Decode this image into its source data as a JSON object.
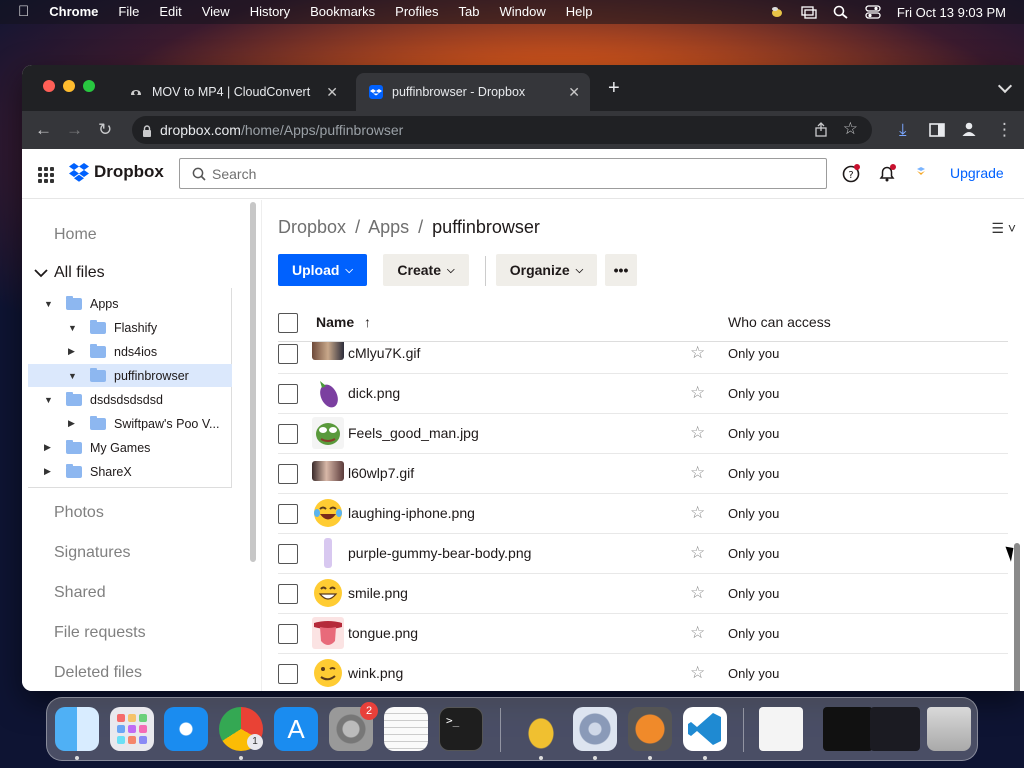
{
  "menubar": {
    "items": [
      "Chrome",
      "File",
      "Edit",
      "View",
      "History",
      "Bookmarks",
      "Profiles",
      "Tab",
      "Window",
      "Help"
    ],
    "clock": "Fri Oct 13  9:03 PM"
  },
  "browser": {
    "tabs": [
      {
        "title": "MOV to MP4 | CloudConvert",
        "icon": "cloudconvert-icon"
      },
      {
        "title": "puffinbrowser - Dropbox",
        "icon": "dropbox-icon"
      }
    ],
    "url_domain": "dropbox.com",
    "url_path": "/home/Apps/puffinbrowser"
  },
  "dropbox": {
    "logo_text": "Dropbox",
    "search_placeholder": "Search",
    "upgrade_label": "Upgrade",
    "colors": {
      "brand": "#0061fe",
      "selected_row": "#dbe8fc",
      "button_bg": "#f0eee9"
    },
    "sidebar": {
      "home": "Home",
      "all_files": "All files",
      "tree": [
        {
          "label": "Apps",
          "expanded": true
        },
        {
          "label": "Flashify",
          "expanded": true
        },
        {
          "label": "nds4ios",
          "expanded": false
        },
        {
          "label": "puffinbrowser",
          "expanded": true,
          "selected": true
        },
        {
          "label": "dsdsdsdsdsd",
          "expanded": true
        },
        {
          "label": "Swiftpaw's Poo V...",
          "expanded": false
        },
        {
          "label": "My Games",
          "expanded": false
        },
        {
          "label": "ShareX",
          "expanded": false
        }
      ],
      "bottom_links": [
        "Photos",
        "Signatures",
        "Shared",
        "File requests",
        "Deleted files"
      ]
    },
    "breadcrumb": {
      "root": "Dropbox",
      "sep": "/",
      "mid": "Apps",
      "current": "puffinbrowser"
    },
    "actions": {
      "upload": "Upload",
      "create": "Create",
      "organize": "Organize",
      "more": "•••"
    },
    "columns": {
      "name": "Name",
      "sort_icon": "↑",
      "access": "Who can access"
    },
    "files": [
      {
        "name": "cMlyu7K.gif",
        "access": "Only you",
        "thumb": "gif-thumb"
      },
      {
        "name": "dick.png",
        "access": "Only you",
        "thumb": "eggplant-thumb"
      },
      {
        "name": "Feels_good_man.jpg",
        "access": "Only you",
        "thumb": "pepe-thumb"
      },
      {
        "name": "l60wlp7.gif",
        "access": "Only you",
        "thumb": "gif-thumb"
      },
      {
        "name": "laughing-iphone.png",
        "access": "Only you",
        "thumb": "laughing-emoji-thumb"
      },
      {
        "name": "purple-gummy-bear-body.png",
        "access": "Only you",
        "thumb": "gummy-bear-thumb"
      },
      {
        "name": "smile.png",
        "access": "Only you",
        "thumb": "smile-emoji-thumb"
      },
      {
        "name": "tongue.png",
        "access": "Only you",
        "thumb": "tongue-thumb"
      },
      {
        "name": "wink.png",
        "access": "Only you",
        "thumb": "wink-emoji-thumb"
      }
    ]
  },
  "dock": {
    "settings_badge": "2",
    "chrome_badge": "1"
  }
}
